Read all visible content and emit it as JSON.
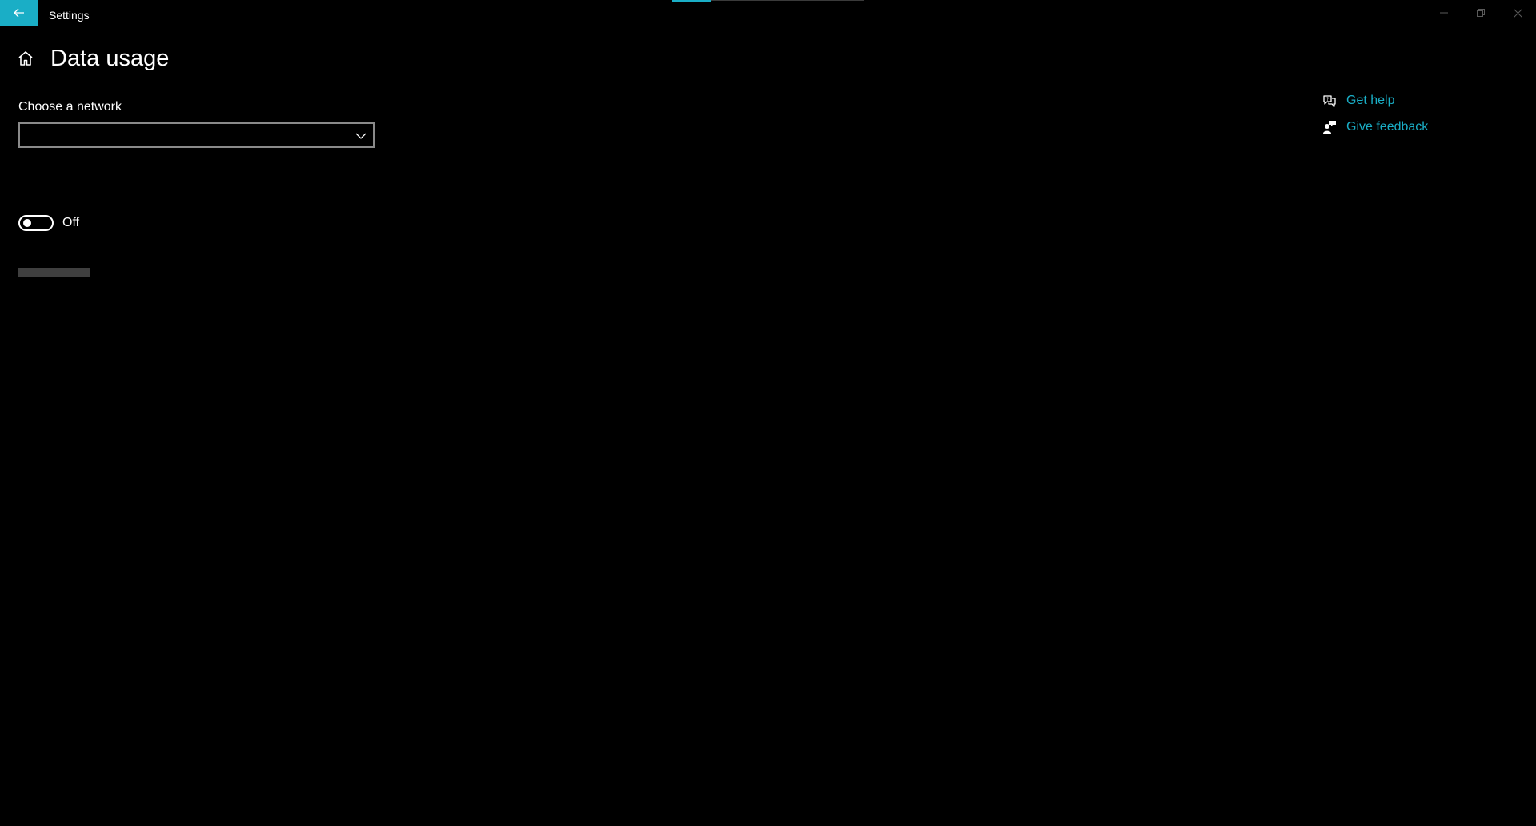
{
  "window": {
    "title": "Settings",
    "accent_color": "#1aaec6",
    "controls": [
      "minimize",
      "restore",
      "close"
    ]
  },
  "header": {
    "title": "Data usage",
    "home_icon": "home-icon"
  },
  "network": {
    "label": "Choose a network",
    "selected_value": ""
  },
  "toggle": {
    "state": "Off",
    "is_on": false
  },
  "side_links": [
    {
      "label": "Get help",
      "icon": "help-chat-icon"
    },
    {
      "label": "Give feedback",
      "icon": "feedback-icon"
    }
  ]
}
